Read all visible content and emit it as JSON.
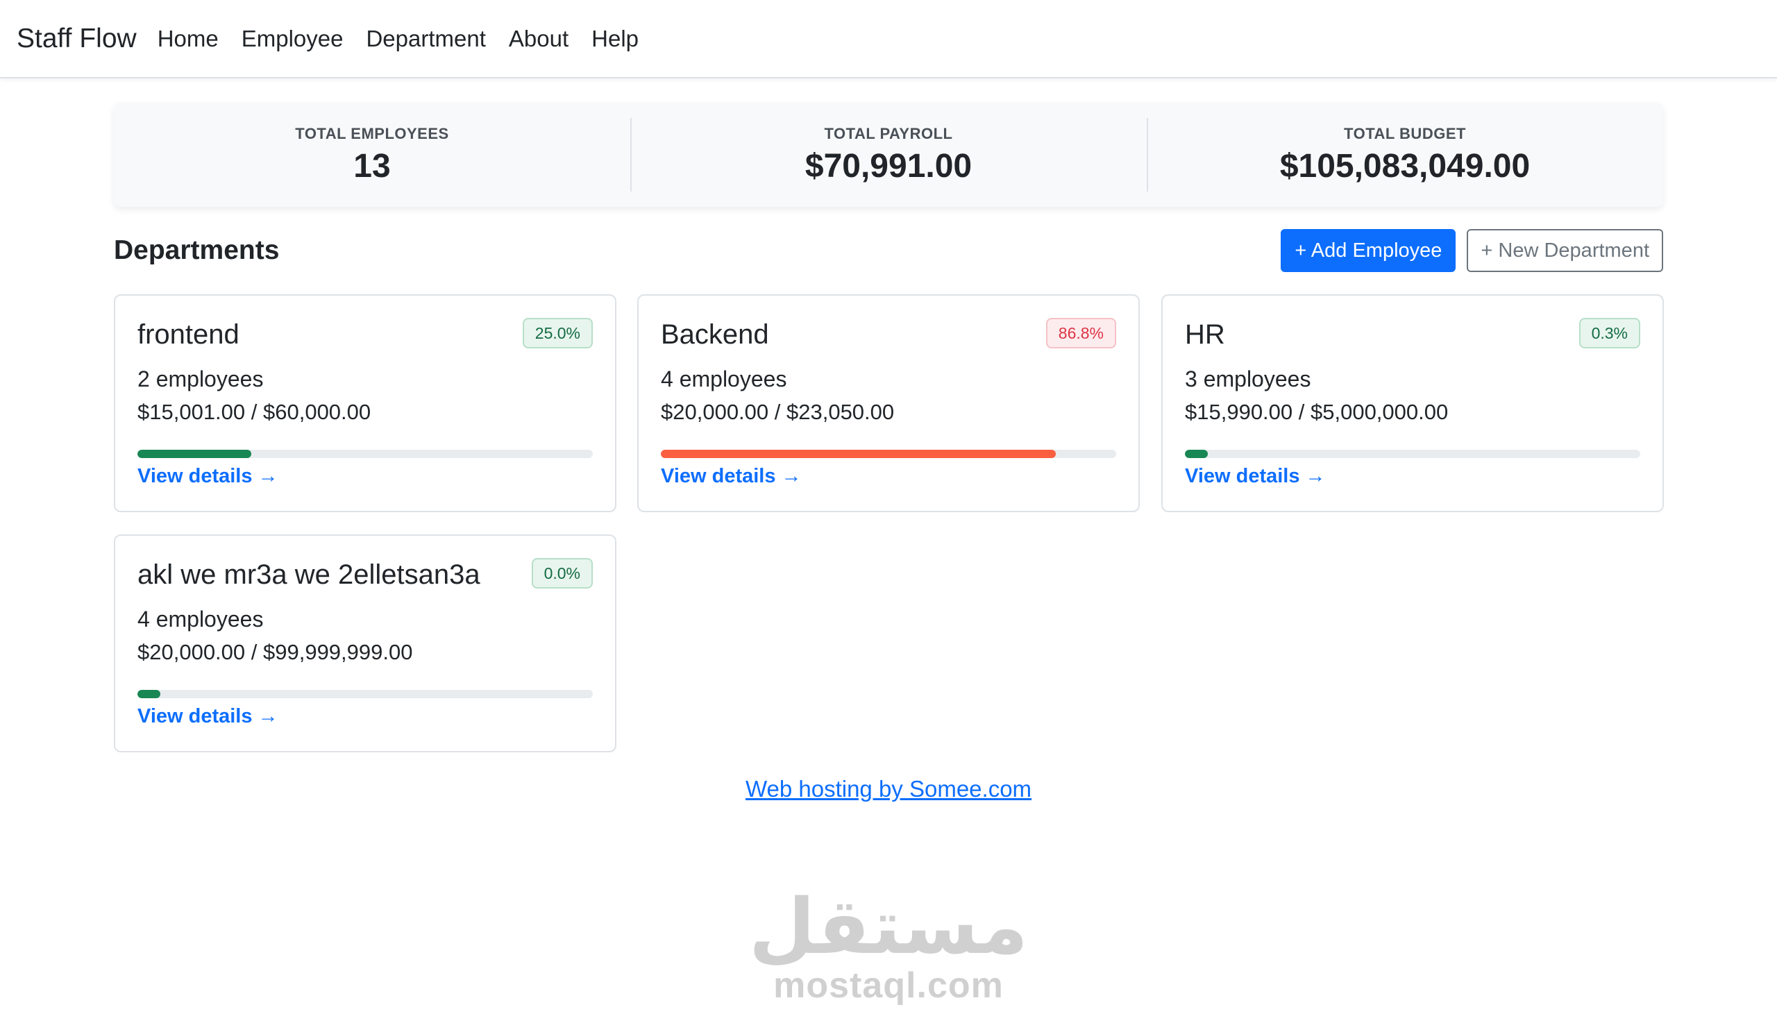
{
  "navbar": {
    "brand": "Staff Flow",
    "links": [
      "Home",
      "Employee",
      "Department",
      "About",
      "Help"
    ]
  },
  "stats": [
    {
      "label": "TOTAL EMPLOYEES",
      "value": "13"
    },
    {
      "label": "TOTAL PAYROLL",
      "value": "$70,991.00"
    },
    {
      "label": "TOTAL BUDGET",
      "value": "$105,083,049.00"
    }
  ],
  "departments_section": {
    "title": "Departments",
    "add_employee_label": "+ Add Employee",
    "new_department_label": "+ New Department"
  },
  "departments": [
    {
      "name": "frontend",
      "percent_label": "25.0%",
      "usage_fraction": 0.25,
      "status": "ok",
      "employees": "2 employees",
      "money": "$15,001.00 / $60,000.00",
      "link": "View details →"
    },
    {
      "name": "Backend",
      "percent_label": "86.8%",
      "usage_fraction": 0.868,
      "status": "over",
      "employees": "4 employees",
      "money": "$20,000.00 / $23,050.00",
      "link": "View details →"
    },
    {
      "name": "HR",
      "percent_label": "0.3%",
      "usage_fraction": 0.003,
      "status": "ok",
      "employees": "3 employees",
      "money": "$15,990.00 / $5,000,000.00",
      "link": "View details →"
    },
    {
      "name": "akl we mr3a we 2elletsan3a",
      "percent_label": "0.0%",
      "usage_fraction": 0.0,
      "status": "ok",
      "employees": "4 employees",
      "money": "$20,000.00 / $99,999,999.00",
      "link": "View details →"
    }
  ],
  "footer": {
    "hosting_link": "Web hosting by Somee.com"
  },
  "watermark": {
    "arabic": "مستقل",
    "latin": "mostaql.com"
  },
  "colors": {
    "primary": "#0d6efd",
    "success": "#198754",
    "danger": "#fa5f3f"
  }
}
